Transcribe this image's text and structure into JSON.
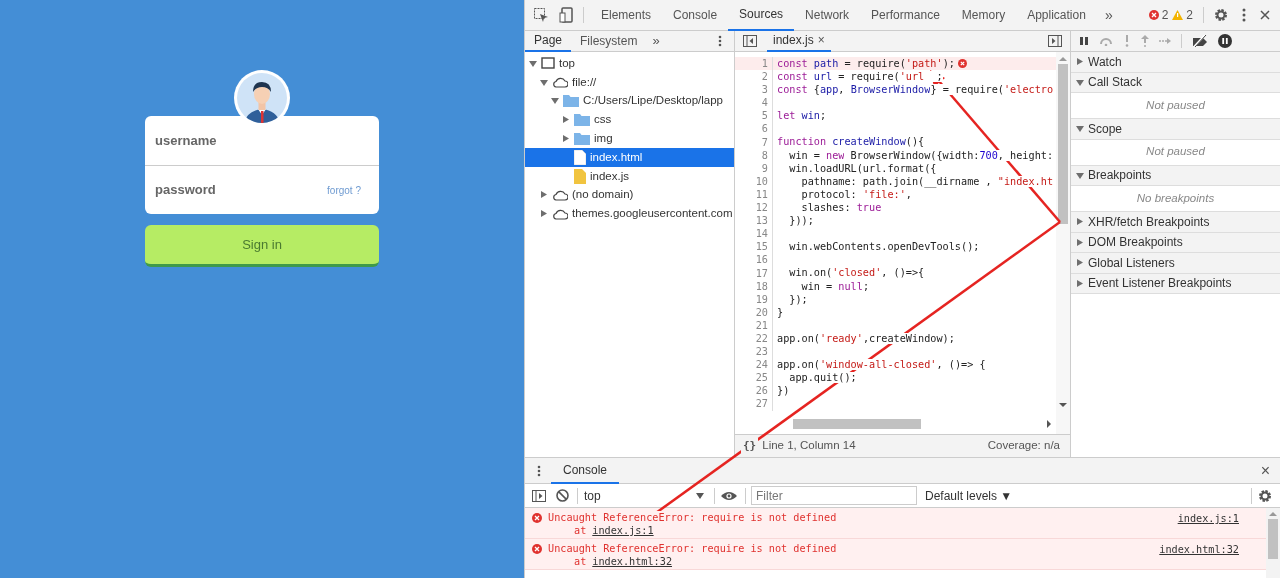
{
  "login": {
    "username_placeholder": "username",
    "password_placeholder": "password",
    "forgot_link": "forgot ?",
    "button": "Sign in"
  },
  "devtools": {
    "tabs": [
      {
        "label": "Elements",
        "selected": false
      },
      {
        "label": "Console",
        "selected": false
      },
      {
        "label": "Sources",
        "selected": true
      },
      {
        "label": "Network",
        "selected": false
      },
      {
        "label": "Performance",
        "selected": false
      },
      {
        "label": "Memory",
        "selected": false
      },
      {
        "label": "Application",
        "selected": false
      }
    ],
    "more_tabs": "»",
    "errors": "2",
    "warnings": "2",
    "navigator": {
      "tabs": [
        {
          "label": "Page",
          "selected": true
        },
        {
          "label": "Filesystem",
          "selected": false
        }
      ],
      "more": "»",
      "tree": [
        {
          "kind": "frame",
          "label": "top",
          "expanded": true,
          "selected": false,
          "children": [
            {
              "kind": "cloud",
              "label": "file://",
              "expanded": true,
              "selected": false,
              "children": [
                {
                  "kind": "folder",
                  "label": "C:/Users/Lipe/Desktop/lapp",
                  "expanded": true,
                  "selected": false,
                  "children": [
                    {
                      "kind": "folder",
                      "label": "css",
                      "expanded": false,
                      "selected": false
                    },
                    {
                      "kind": "folder",
                      "label": "img",
                      "expanded": false,
                      "selected": false
                    },
                    {
                      "kind": "html",
                      "label": "index.html",
                      "selected": true
                    },
                    {
                      "kind": "js",
                      "label": "index.js",
                      "selected": false
                    }
                  ]
                }
              ]
            },
            {
              "kind": "cloud",
              "label": "(no domain)",
              "expanded": false,
              "selected": false
            },
            {
              "kind": "cloud",
              "label": "themes.googleusercontent.com",
              "expanded": false,
              "selected": false
            }
          ]
        }
      ]
    },
    "editor": {
      "tab": "index.js",
      "close": "×",
      "lines": [
        {
          "number": "1",
          "error": true,
          "tokens": [
            {
              "kind": "kw",
              "text": "const"
            },
            {
              "kind": "def",
              "text": " path"
            },
            {
              "kind": "plain",
              "text": " = require("
            },
            {
              "kind": "str",
              "text": "'path'"
            },
            {
              "kind": "plain",
              "text": ");"
            }
          ]
        },
        {
          "number": "2",
          "error": false,
          "tokens": [
            {
              "kind": "kw",
              "text": "const"
            },
            {
              "kind": "def",
              "text": " url"
            },
            {
              "kind": "plain",
              "text": " = require("
            },
            {
              "kind": "str",
              "text": "'url"
            },
            {
              "kind": "plain",
              "text": "  ;"
            }
          ]
        },
        {
          "number": "3",
          "error": false,
          "tokens": [
            {
              "kind": "kw",
              "text": "const"
            },
            {
              "kind": "plain",
              "text": " {"
            },
            {
              "kind": "def",
              "text": "app"
            },
            {
              "kind": "plain",
              "text": ", "
            },
            {
              "kind": "def",
              "text": "BrowserWindow"
            },
            {
              "kind": "plain",
              "text": "} = require("
            },
            {
              "kind": "str",
              "text": "'electro"
            }
          ]
        },
        {
          "number": "4",
          "error": false
        },
        {
          "number": "5",
          "error": false,
          "tokens": [
            {
              "kind": "kw",
              "text": "let"
            },
            {
              "kind": "def",
              "text": " win"
            },
            {
              "kind": "plain",
              "text": ";"
            }
          ]
        },
        {
          "number": "6",
          "error": false
        },
        {
          "number": "7",
          "error": false,
          "tokens": [
            {
              "kind": "kw",
              "text": "function"
            },
            {
              "kind": "def",
              "text": " createWindow"
            },
            {
              "kind": "plain",
              "text": "(){"
            }
          ]
        },
        {
          "number": "8",
          "error": false,
          "tokens": [
            {
              "kind": "plain",
              "text": "  win = "
            },
            {
              "kind": "kw",
              "text": "new"
            },
            {
              "kind": "plain",
              "text": " BrowserWindow({width:"
            },
            {
              "kind": "num",
              "text": "700"
            },
            {
              "kind": "plain",
              "text": ", height:"
            }
          ]
        },
        {
          "number": "9",
          "error": false,
          "tokens": [
            {
              "kind": "plain",
              "text": "  win.loadURL(url.format({"
            }
          ]
        },
        {
          "number": "10",
          "error": false,
          "tokens": [
            {
              "kind": "plain",
              "text": "    pathname: path.join(__dirname , "
            },
            {
              "kind": "str",
              "text": "\"index.ht"
            }
          ]
        },
        {
          "number": "11",
          "error": false,
          "tokens": [
            {
              "kind": "plain",
              "text": "    protocol: "
            },
            {
              "kind": "str",
              "text": "'file:'"
            },
            {
              "kind": "plain",
              "text": ","
            }
          ]
        },
        {
          "number": "12",
          "error": false,
          "tokens": [
            {
              "kind": "plain",
              "text": "    slashes: "
            },
            {
              "kind": "kw",
              "text": "true"
            }
          ]
        },
        {
          "number": "13",
          "error": false,
          "tokens": [
            {
              "kind": "plain",
              "text": "  }));"
            }
          ]
        },
        {
          "number": "14",
          "error": false
        },
        {
          "number": "15",
          "error": false,
          "tokens": [
            {
              "kind": "plain",
              "text": "  win.webContents.openDevTools();"
            }
          ]
        },
        {
          "number": "16",
          "error": false
        },
        {
          "number": "17",
          "error": false,
          "tokens": [
            {
              "kind": "plain",
              "text": "  win.on("
            },
            {
              "kind": "str",
              "text": "'closed'"
            },
            {
              "kind": "plain",
              "text": ", ()=>{"
            }
          ]
        },
        {
          "number": "18",
          "error": false,
          "tokens": [
            {
              "kind": "plain",
              "text": "    win = "
            },
            {
              "kind": "kw",
              "text": "null"
            },
            {
              "kind": "plain",
              "text": ";"
            }
          ]
        },
        {
          "number": "19",
          "error": false,
          "tokens": [
            {
              "kind": "plain",
              "text": "  });"
            }
          ]
        },
        {
          "number": "20",
          "error": false,
          "tokens": [
            {
              "kind": "plain",
              "text": "}"
            }
          ]
        },
        {
          "number": "21",
          "error": false
        },
        {
          "number": "22",
          "error": false,
          "tokens": [
            {
              "kind": "plain",
              "text": "app.on("
            },
            {
              "kind": "str",
              "text": "'ready'"
            },
            {
              "kind": "plain",
              "text": ",createWindow);"
            }
          ]
        },
        {
          "number": "23",
          "error": false
        },
        {
          "number": "24",
          "error": false,
          "tokens": [
            {
              "kind": "plain",
              "text": "app.on("
            },
            {
              "kind": "str",
              "text": "'window-all-closed'"
            },
            {
              "kind": "plain",
              "text": ", ()=> {"
            }
          ]
        },
        {
          "number": "25",
          "error": false,
          "tokens": [
            {
              "kind": "plain",
              "text": "  app.quit();"
            }
          ]
        },
        {
          "number": "26",
          "error": false,
          "tokens": [
            {
              "kind": "plain",
              "text": "})"
            }
          ]
        },
        {
          "number": "27",
          "error": false
        }
      ],
      "format_button": "{}",
      "status": "Line 1, Column 14",
      "coverage": "Coverage: n/a"
    },
    "debugger": {
      "sections": [
        {
          "title": "Watch",
          "expanded": false
        },
        {
          "title": "Call Stack",
          "expanded": true,
          "message": "Not paused"
        },
        {
          "title": "Scope",
          "expanded": true,
          "message": "Not paused"
        },
        {
          "title": "Breakpoints",
          "expanded": true,
          "message": "No breakpoints"
        },
        {
          "title": "XHR/fetch Breakpoints",
          "expanded": false
        },
        {
          "title": "DOM Breakpoints",
          "expanded": false
        },
        {
          "title": "Global Listeners",
          "expanded": false
        },
        {
          "title": "Event Listener Breakpoints",
          "expanded": false
        }
      ]
    },
    "console": {
      "tab": "Console",
      "close": "×",
      "context": "top",
      "filter_placeholder": "Filter",
      "levels": "Default levels ▼",
      "messages": [
        {
          "kind": "error",
          "text": "Uncaught ReferenceError: require is not defined",
          "at": "at",
          "location": "index.js:1",
          "source": "index.js:1"
        },
        {
          "kind": "error",
          "text": "Uncaught ReferenceError: require is not defined",
          "at": "at",
          "location": "index.html:32",
          "source": "index.html:32"
        }
      ]
    }
  }
}
